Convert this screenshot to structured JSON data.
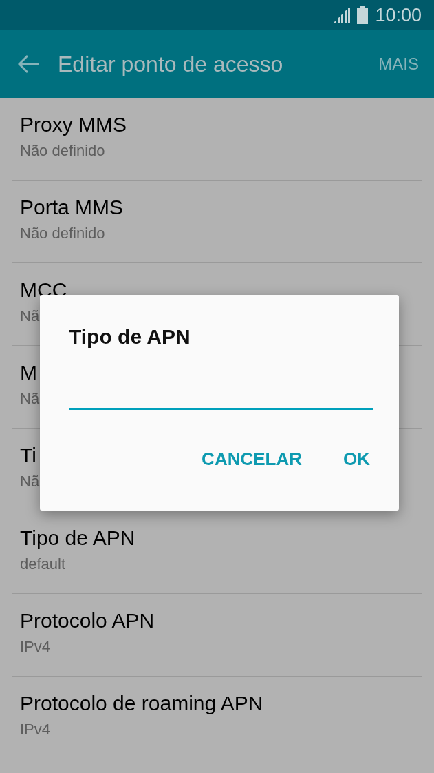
{
  "status_bar": {
    "time": "10:00"
  },
  "app_bar": {
    "title": "Editar ponto de acesso",
    "action": "MAIS"
  },
  "settings": [
    {
      "title": "Proxy MMS",
      "value": "Não definido"
    },
    {
      "title": "Porta MMS",
      "value": "Não definido"
    },
    {
      "title": "MCC",
      "value": "Nã"
    },
    {
      "title": "M",
      "value": "Nã"
    },
    {
      "title": "Ti",
      "value": "Nã"
    },
    {
      "title": "Tipo de APN",
      "value": "default"
    },
    {
      "title": "Protocolo APN",
      "value": "IPv4"
    },
    {
      "title": "Protocolo de roaming APN",
      "value": "IPv4"
    }
  ],
  "dialog": {
    "title": "Tipo de APN",
    "buttons": [
      "CANCELAR",
      "OK"
    ]
  }
}
